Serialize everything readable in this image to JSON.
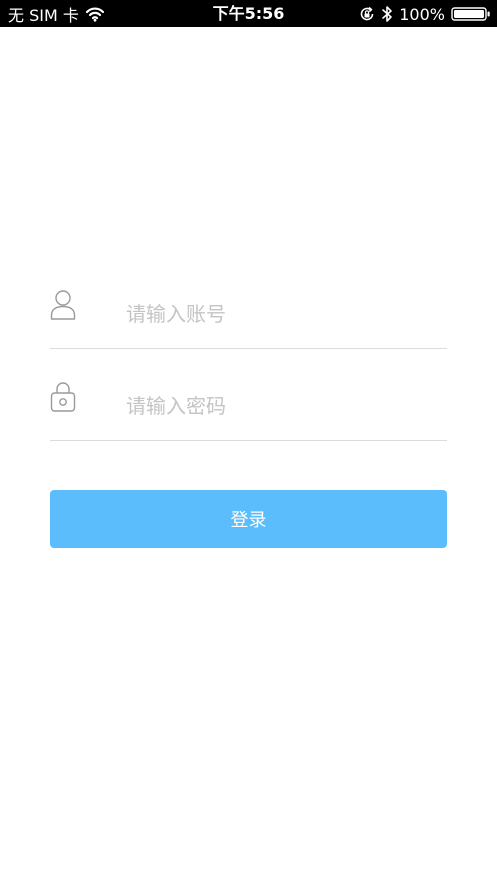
{
  "status_bar": {
    "carrier": "无 SIM 卡",
    "time": "下午5:56",
    "battery_percent": "100%",
    "icons": {
      "wifi": "wifi-icon",
      "orientation_lock": "orientation-lock-icon",
      "bluetooth": "bluetooth-icon",
      "battery": "battery-icon"
    }
  },
  "login_form": {
    "account": {
      "placeholder": "请输入账号",
      "value": "",
      "icon": "user-icon"
    },
    "password": {
      "placeholder": "请输入密码",
      "value": "",
      "icon": "lock-icon"
    },
    "submit_label": "登录"
  },
  "colors": {
    "status_bar_bg": "#000000",
    "button_bg": "#5cbdfc",
    "button_text": "#ffffff",
    "placeholder": "#c4c4c4",
    "divider": "#dcdcdc",
    "icon": "#9a9a9a"
  }
}
